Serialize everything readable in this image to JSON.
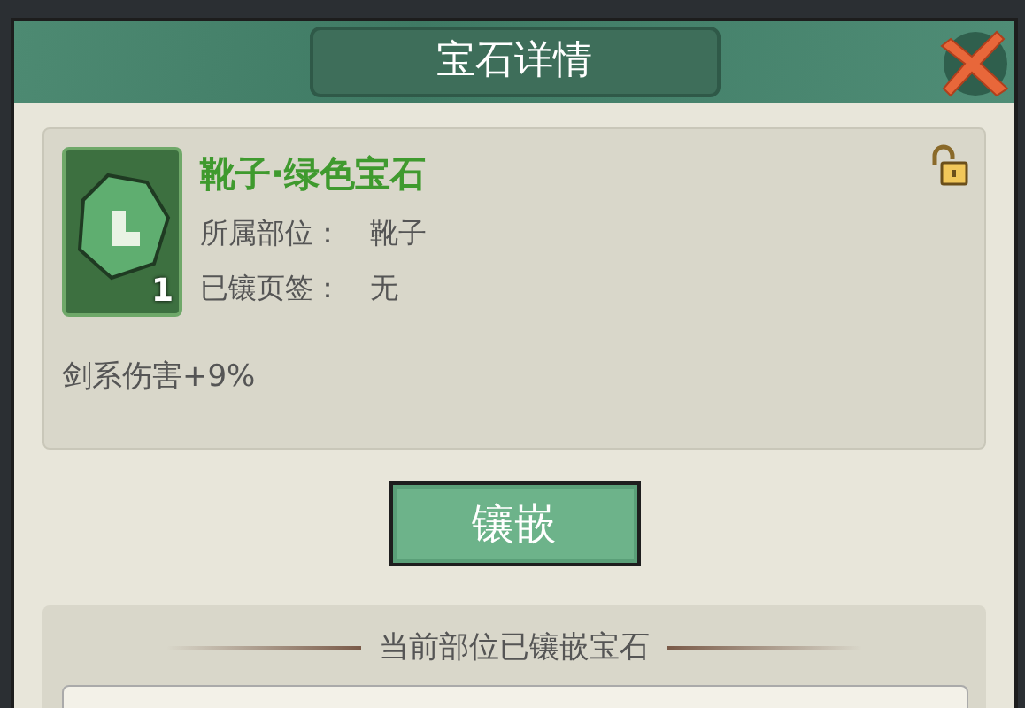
{
  "dialog": {
    "title": "宝石详情"
  },
  "gem": {
    "name": "靴子·绿色宝石",
    "count": "1",
    "locked": false,
    "fields": [
      {
        "label": "所属部位：",
        "value": "靴子"
      },
      {
        "label": "已镶页签：",
        "value": "无"
      }
    ],
    "effect": "剑系伤害+9%"
  },
  "button": "镶嵌",
  "section": {
    "title": "当前部位已镶嵌宝石"
  }
}
